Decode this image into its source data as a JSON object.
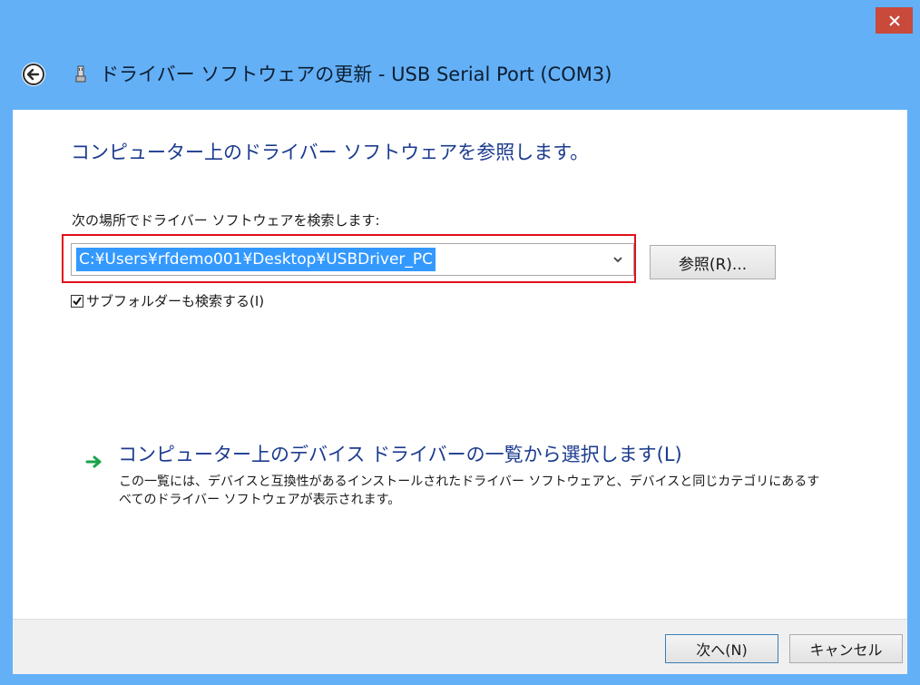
{
  "window": {
    "title": "ドライバー ソフトウェアの更新 - USB Serial Port (COM3)",
    "close_icon": "close-icon",
    "back_icon": "back-arrow-icon",
    "device_icon": "usb-device-icon",
    "frame_color": "#63b0f7",
    "close_color": "#c9493b"
  },
  "main": {
    "heading": "コンピューター上のドライバー ソフトウェアを参照します。",
    "search_label": "次の場所でドライバー ソフトウェアを検索します:",
    "path_value": "C:¥Users¥rfdemo001¥Desktop¥USBDriver_PC",
    "browse_label": "参照(R)...",
    "include_subfolders_label": "サブフォルダーも検索する(I)",
    "include_subfolders_checked": true,
    "pick_title": "コンピューター上のデバイス ドライバーの一覧から選択します(L)",
    "pick_description": "この一覧には、デバイスと互換性があるインストールされたドライバー ソフトウェアと、デバイスと同じカテゴリにあるすべてのドライバー ソフトウェアが表示されます。",
    "accent_color": "#1c3b8f",
    "highlight_color": "#e0101c",
    "selection_color": "#3399ff"
  },
  "footer": {
    "next_label": "次へ(N)",
    "cancel_label": "キャンセル"
  }
}
